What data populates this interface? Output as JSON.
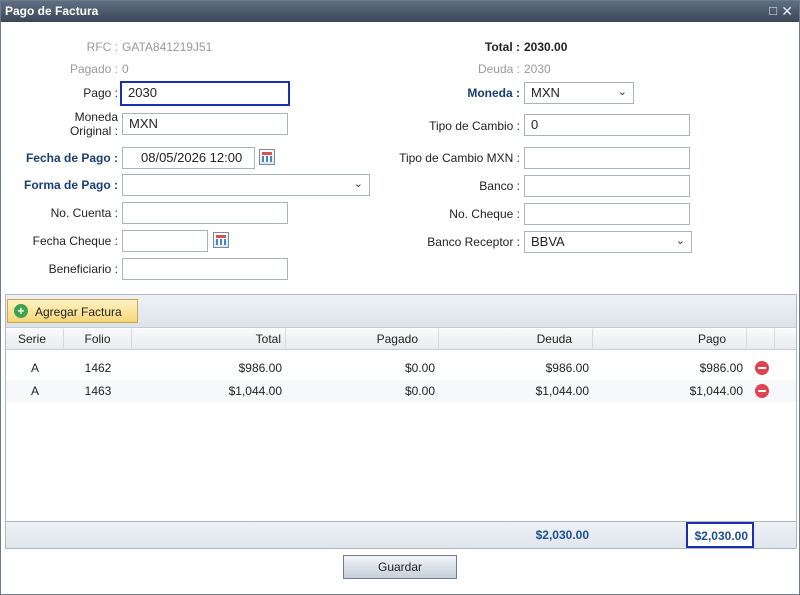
{
  "window": {
    "title": "Pago de Factura"
  },
  "left": {
    "rfc_label": "RFC :",
    "rfc_value": "GATA841219J51",
    "pagado_label": "Pagado :",
    "pagado_value": "0",
    "pago_label": "Pago :",
    "pago_value": "2030",
    "moneda_original_label": "Moneda\nOriginal :",
    "moneda_original_value": "MXN",
    "fecha_pago_label": "Fecha de Pago :",
    "fecha_pago_value": "08/05/2026 12:00",
    "forma_pago_label": "Forma de Pago :",
    "forma_pago_value": "",
    "no_cuenta_label": "No. Cuenta :",
    "no_cuenta_value": "",
    "fecha_cheque_label": "Fecha Cheque :",
    "fecha_cheque_value": "",
    "beneficiario_label": "Beneficiario :",
    "beneficiario_value": ""
  },
  "right": {
    "total_label": "Total :",
    "total_value": "2030.00",
    "deuda_label": "Deuda :",
    "deuda_value": "2030",
    "moneda_label": "Moneda :",
    "moneda_value": "MXN",
    "tipo_cambio_label": "Tipo de Cambio :",
    "tipo_cambio_value": "0",
    "tipo_cambio_mxn_label": "Tipo de Cambio MXN :",
    "tipo_cambio_mxn_value": "",
    "banco_label": "Banco :",
    "banco_value": "",
    "no_cheque_label": "No. Cheque :",
    "no_cheque_value": "",
    "banco_receptor_label": "Banco Receptor :",
    "banco_receptor_value": "BBVA"
  },
  "grid": {
    "add_button": "Agregar Factura",
    "columns": [
      "Serie",
      "Folio",
      "Total",
      "Pagado",
      "Deuda",
      "Pago"
    ],
    "rows": [
      {
        "serie": "A",
        "folio": "1462",
        "total": "$986.00",
        "pagado": "$0.00",
        "deuda": "$986.00",
        "pago": "$986.00"
      },
      {
        "serie": "A",
        "folio": "1463",
        "total": "$1,044.00",
        "pagado": "$0.00",
        "deuda": "$1,044.00",
        "pago": "$1,044.00"
      }
    ],
    "footer": {
      "deuda_total": "$2,030.00",
      "pago_total": "$2,030.00"
    }
  },
  "actions": {
    "save_label": "Guardar"
  },
  "icons": {
    "restore": "restore-icon",
    "close": "close-icon",
    "calendar": "calendar-icon",
    "add": "add-circle-icon",
    "remove": "remove-circle-icon"
  },
  "colors": {
    "titlebar": "#3a4656",
    "label_blue": "#1a3d73",
    "focus_border": "#1a2fb0",
    "total_text": "#1a4f93",
    "add_button": "#f5d67a",
    "remove": "#e0454f"
  }
}
